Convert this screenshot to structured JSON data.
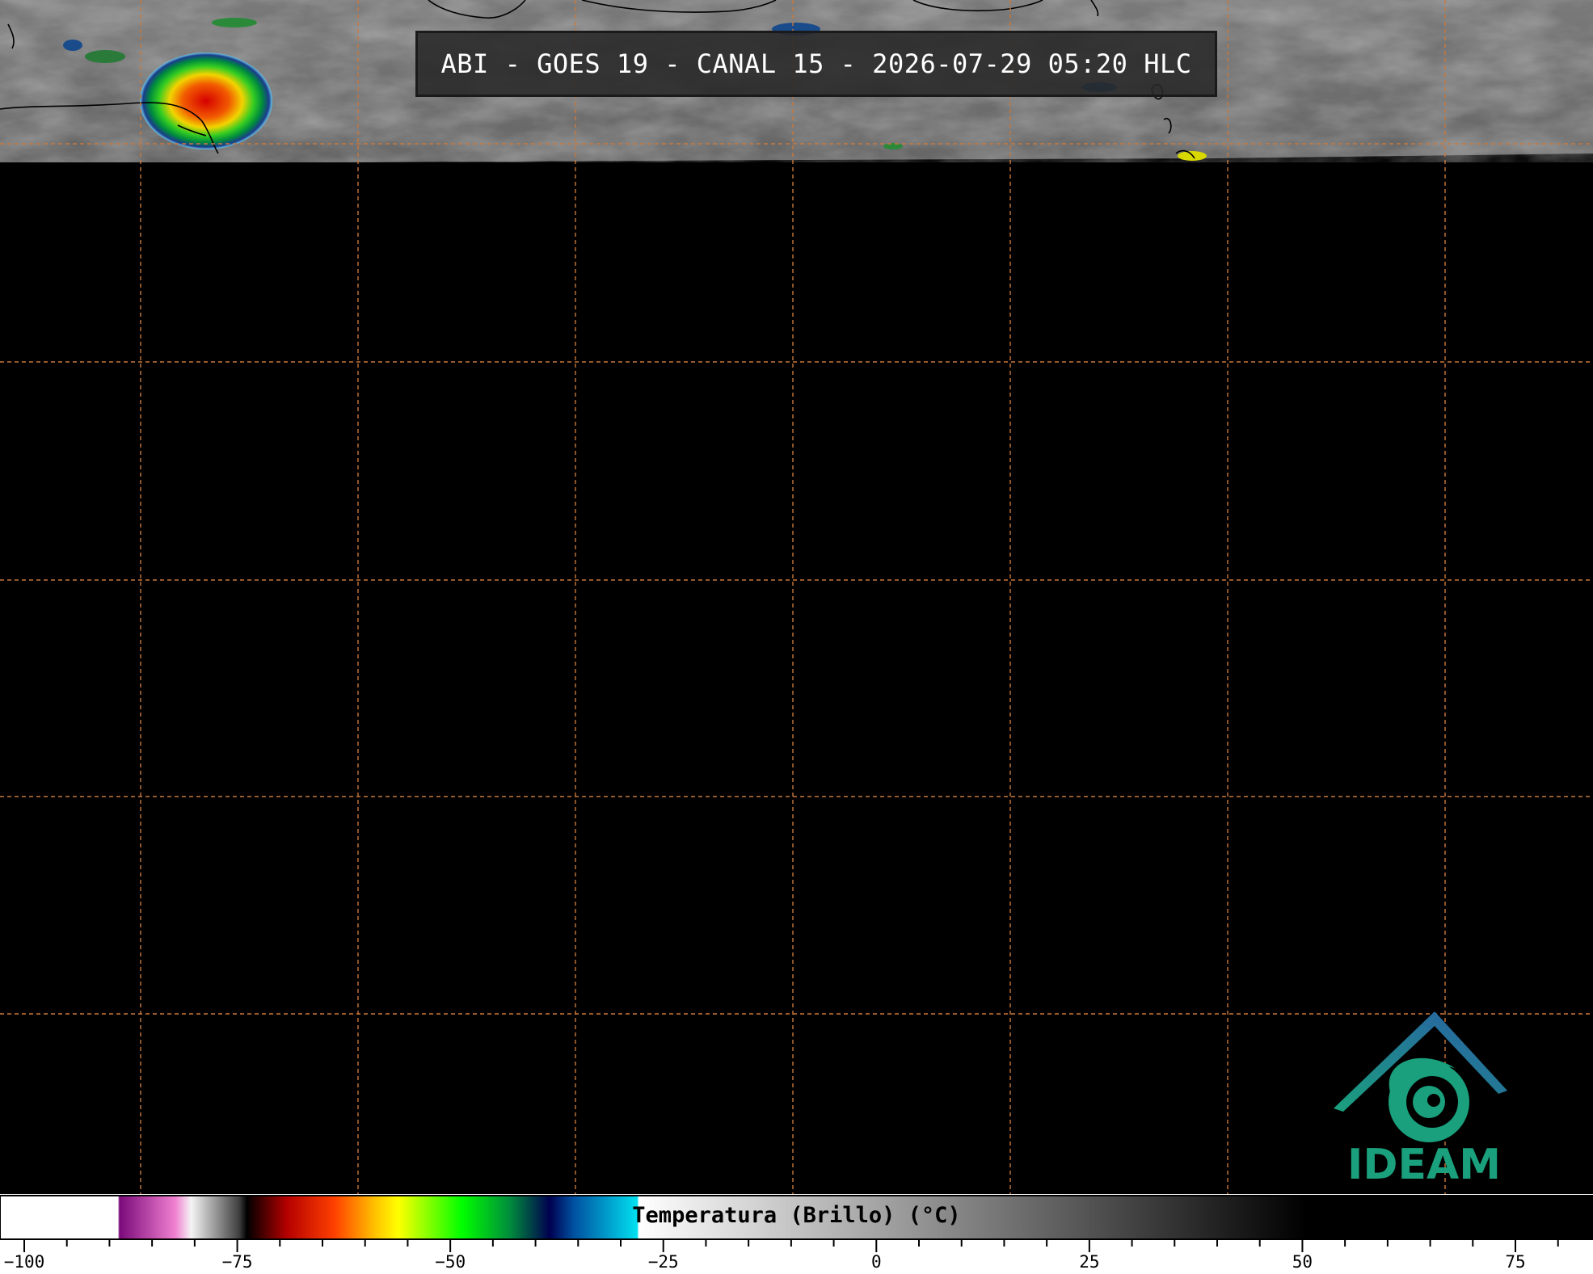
{
  "title": "ABI - GOES 19 - CANAL 15 - 2026-07-29 05:20 HLC",
  "logo_text": "IDEAM",
  "colorbar": {
    "label": "Temperatura (Brillo) (°C)",
    "min": -100,
    "max": 83,
    "ticks": [
      "−100",
      "−75",
      "−50",
      "−25",
      "0",
      "25",
      "50",
      "75"
    ],
    "tick_values": [
      -100,
      -75,
      -50,
      -25,
      0,
      25,
      50,
      75
    ],
    "minor_step": 5
  },
  "colors": {
    "grid": "#c8783c",
    "coast": "#000000",
    "brand": "#1aa07c"
  }
}
